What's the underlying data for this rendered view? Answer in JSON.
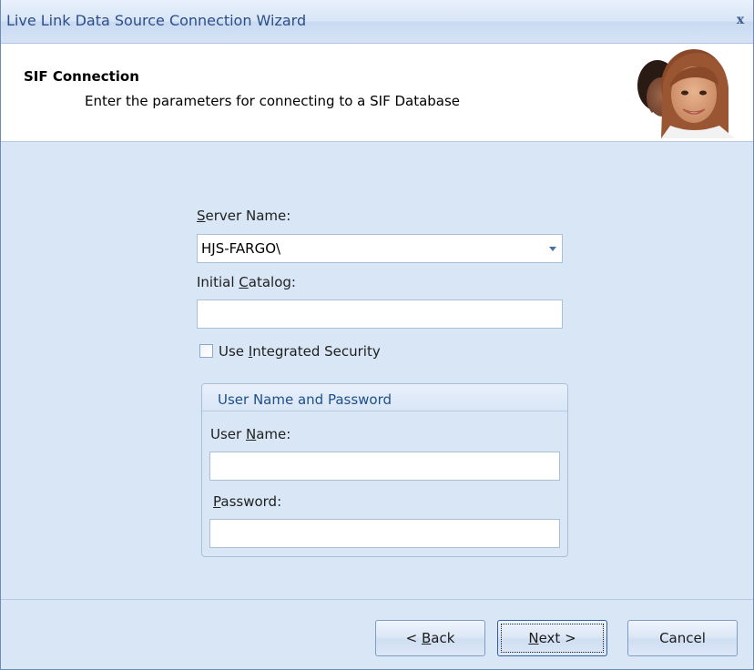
{
  "window": {
    "title": "Live Link Data Source Connection Wizard",
    "close_glyph": "x"
  },
  "header": {
    "title": "SIF Connection",
    "subtitle": "Enter the  parameters for connecting to a SIF Database",
    "image_icon": "people-photo"
  },
  "form": {
    "server_name": {
      "label_prefix": "",
      "label_mnemonic": "S",
      "label_rest": "erver Name:",
      "value": "HJS-FARGO\\"
    },
    "initial_catalog": {
      "label_prefix": "Initial ",
      "label_mnemonic": "C",
      "label_rest": "atalog:",
      "value": ""
    },
    "integrated_security": {
      "label_prefix": "Use ",
      "label_mnemonic": "I",
      "label_rest": "ntegrated Security",
      "checked": false
    },
    "credentials_group": {
      "title": "User Name and Password",
      "user_name": {
        "label_prefix": "User ",
        "label_mnemonic": "N",
        "label_rest": "ame:",
        "value": ""
      },
      "password": {
        "label_prefix": "",
        "label_mnemonic": "P",
        "label_rest": "assword:",
        "value": ""
      }
    }
  },
  "buttons": {
    "back": {
      "prefix": "< ",
      "mnemonic": "B",
      "rest": "ack"
    },
    "next": {
      "prefix": "",
      "mnemonic": "N",
      "rest": "ext >"
    },
    "cancel": {
      "label": "Cancel"
    }
  },
  "colors": {
    "accent": "#1f4e8c",
    "panel_background": "#d9e6f6",
    "title_text": "#2b4d8a"
  }
}
